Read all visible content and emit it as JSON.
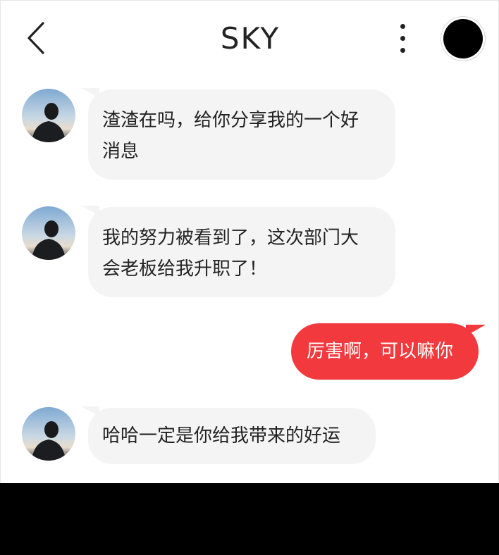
{
  "header": {
    "back_icon": "chevron-left-icon",
    "title": "SKY",
    "more_icon": "more-vertical-icon",
    "avatar_icon": "profile-avatar"
  },
  "messages": [
    {
      "from": "other",
      "text_line1": "渣渣在吗，给你分享我的一个好",
      "text_line2": "消息"
    },
    {
      "from": "other",
      "text_line1": "我的努力被看到了，这次部门大",
      "text_line2": "会老板给我升职了！"
    },
    {
      "from": "me",
      "text_line1": "厉害啊，可以嘛你"
    },
    {
      "from": "other",
      "text_line1": "哈哈一定是你给我带来的好运"
    }
  ],
  "colors": {
    "incoming_bubble": "#f4f4f4",
    "outgoing_bubble": "#f2393d",
    "bottom_bar": "#000000"
  }
}
